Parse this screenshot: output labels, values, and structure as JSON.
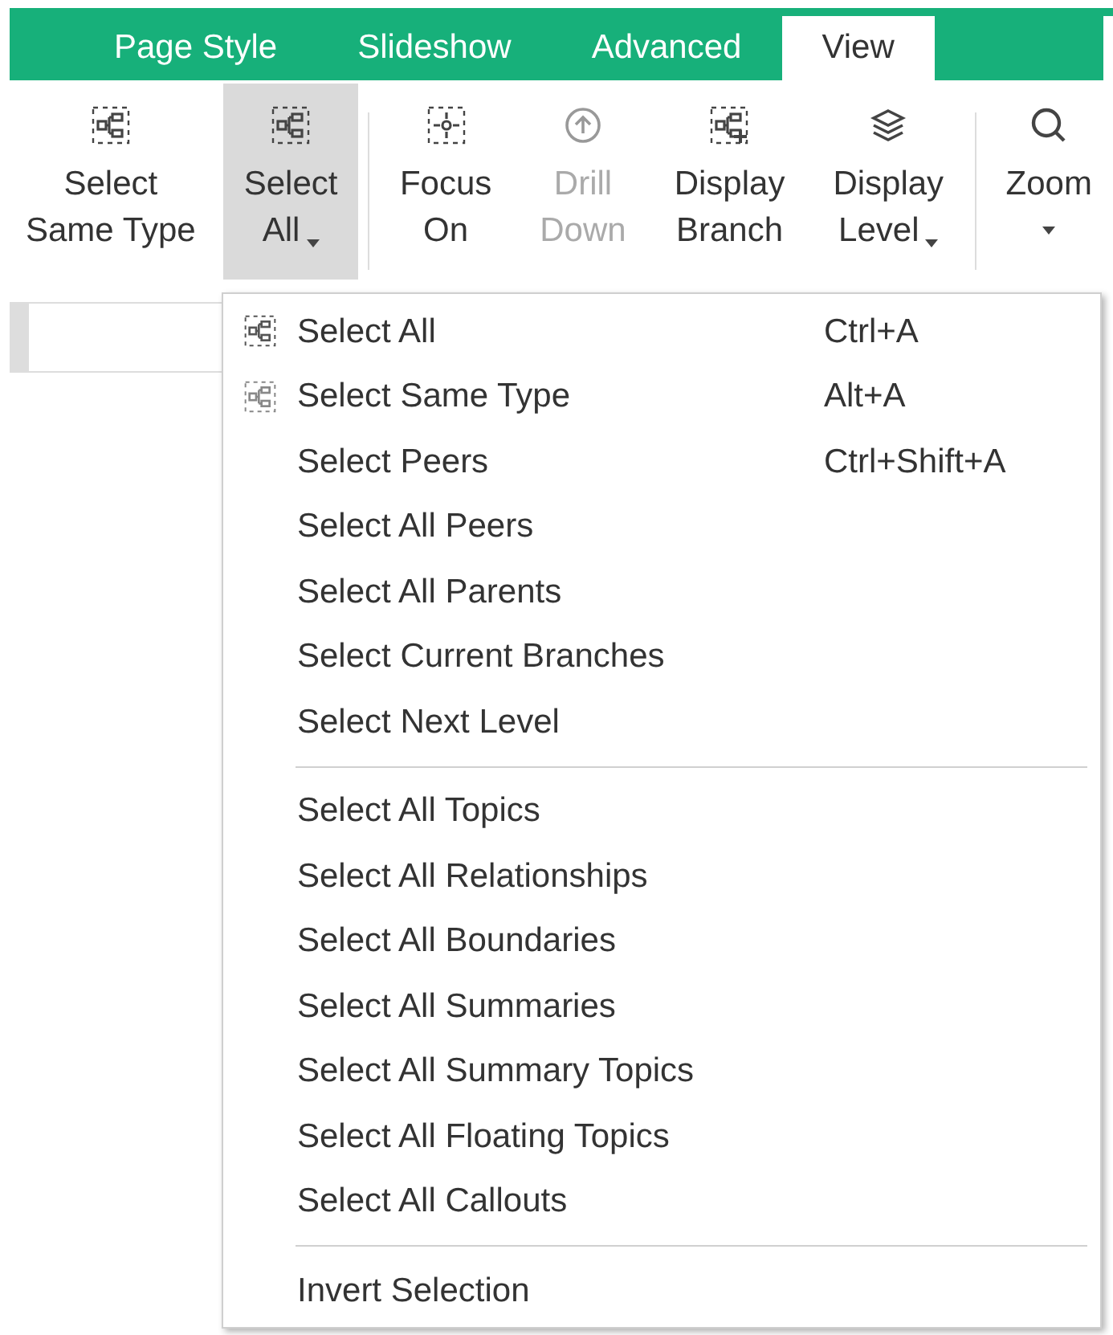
{
  "tabs": [
    {
      "label": "Page Style",
      "selected": false
    },
    {
      "label": "Slideshow",
      "selected": false
    },
    {
      "label": "Advanced",
      "selected": false
    },
    {
      "label": "View",
      "selected": true
    }
  ],
  "ribbon": {
    "groups": [
      [
        {
          "lines": [
            "Select",
            "Same Type"
          ],
          "kind": "select-same",
          "dropdown": false,
          "pressed": false,
          "disabled": false
        },
        {
          "lines": [
            "Select",
            "All"
          ],
          "kind": "select-all",
          "dropdown": true,
          "pressed": true,
          "disabled": false
        }
      ],
      [
        {
          "lines": [
            "Focus",
            "On"
          ],
          "kind": "focus",
          "dropdown": false,
          "pressed": false,
          "disabled": false
        },
        {
          "lines": [
            "Drill",
            "Down"
          ],
          "kind": "drill",
          "dropdown": false,
          "pressed": false,
          "disabled": true
        },
        {
          "lines": [
            "Display",
            "Branch"
          ],
          "kind": "branch",
          "dropdown": false,
          "pressed": false,
          "disabled": false
        },
        {
          "lines": [
            "Display",
            "Level"
          ],
          "kind": "layers",
          "dropdown": true,
          "pressed": false,
          "disabled": false
        }
      ],
      [
        {
          "lines": [
            "Zoom"
          ],
          "kind": "zoom",
          "dropdown": true,
          "pressed": false,
          "disabled": false
        }
      ]
    ]
  },
  "menu": {
    "sections": [
      [
        {
          "label": "Select All",
          "shortcut": "Ctrl+A",
          "kind": "icon"
        },
        {
          "label": "Select Same Type",
          "shortcut": "Alt+A",
          "kind": "icon2"
        },
        {
          "label": "Select Peers",
          "shortcut": "Ctrl+Shift+A",
          "kind": "plain"
        },
        {
          "label": "Select All Peers",
          "kind": "plain"
        },
        {
          "label": "Select All Parents",
          "kind": "plain"
        },
        {
          "label": "Select Current Branches",
          "kind": "plain"
        },
        {
          "label": "Select Next Level",
          "kind": "plain"
        }
      ],
      [
        {
          "label": "Select All Topics",
          "kind": "plain"
        },
        {
          "label": "Select All Relationships",
          "kind": "plain"
        },
        {
          "label": "Select All Boundaries",
          "kind": "plain"
        },
        {
          "label": "Select All Summaries",
          "kind": "plain"
        },
        {
          "label": "Select All Summary Topics",
          "kind": "plain"
        },
        {
          "label": "Select All Floating Topics",
          "kind": "plain"
        },
        {
          "label": "Select All Callouts",
          "kind": "plain"
        }
      ],
      [
        {
          "label": "Invert Selection",
          "kind": "plain"
        }
      ]
    ]
  }
}
